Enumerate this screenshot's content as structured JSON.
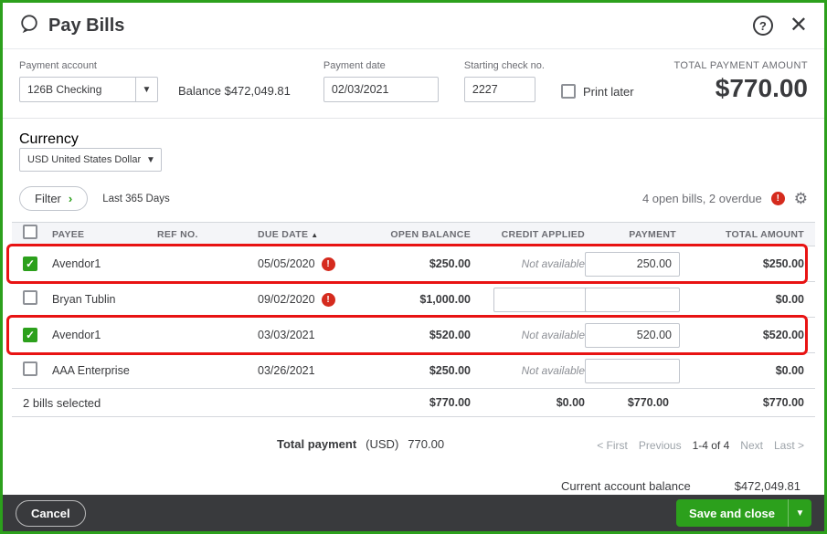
{
  "header": {
    "title": "Pay Bills"
  },
  "payment": {
    "account_label": "Payment account",
    "account_value": "126B Checking",
    "balance_text": "Balance $472,049.81",
    "date_label": "Payment date",
    "date_value": "02/03/2021",
    "check_label": "Starting check no.",
    "check_value": "2227",
    "print_later_label": "Print later",
    "total_label": "TOTAL PAYMENT AMOUNT",
    "total_value": "$770.00"
  },
  "currency": {
    "label": "Currency",
    "value": "USD United States Dollar"
  },
  "filter": {
    "button_label": "Filter",
    "chevron": "›",
    "range_label": "Last 365 Days",
    "status": "4 open bills, 2 overdue"
  },
  "table": {
    "columns": {
      "payee": "PAYEE",
      "ref": "REF NO.",
      "due_date": "DUE DATE",
      "open_balance": "OPEN BALANCE",
      "credit_applied": "CREDIT APPLIED",
      "payment": "PAYMENT",
      "total_amount": "TOTAL AMOUNT"
    },
    "rows": [
      {
        "checked": true,
        "highlighted": true,
        "payee": "Avendor1",
        "ref": "",
        "due_date": "05/05/2020",
        "overdue": true,
        "open_balance": "$250.00",
        "credit": "Not available",
        "payment": "250.00",
        "total": "$250.00"
      },
      {
        "checked": false,
        "highlighted": false,
        "payee": "Bryan Tublin",
        "ref": "",
        "due_date": "09/02/2020",
        "overdue": true,
        "open_balance": "$1,000.00",
        "credit": "",
        "payment": "",
        "total": "$0.00"
      },
      {
        "checked": true,
        "highlighted": true,
        "payee": "Avendor1",
        "ref": "",
        "due_date": "03/03/2021",
        "overdue": false,
        "open_balance": "$520.00",
        "credit": "Not available",
        "payment": "520.00",
        "total": "$520.00"
      },
      {
        "checked": false,
        "highlighted": false,
        "payee": "AAA Enterprise",
        "ref": "",
        "due_date": "03/26/2021",
        "overdue": false,
        "open_balance": "$250.00",
        "credit": "Not available",
        "payment": "",
        "total": "$0.00"
      }
    ],
    "summary": {
      "selected": "2 bills selected",
      "open_balance": "$770.00",
      "credit": "$0.00",
      "payment": "$770.00",
      "total": "$770.00"
    }
  },
  "totals": {
    "label": "Total payment",
    "currency": "(USD)",
    "value": "770.00"
  },
  "pagination": {
    "first": "< First",
    "previous": "Previous",
    "range": "1-4 of 4",
    "next": "Next",
    "last": "Last >"
  },
  "account_balance": {
    "label": "Current account balance",
    "value": "$472,049.81"
  },
  "footer": {
    "cancel": "Cancel",
    "save": "Save and close"
  },
  "colors": {
    "brand_green": "#2ca01c",
    "overdue_red": "#d52b1e",
    "annotation_red": "#e81313",
    "footer_dark": "#393a3d"
  }
}
